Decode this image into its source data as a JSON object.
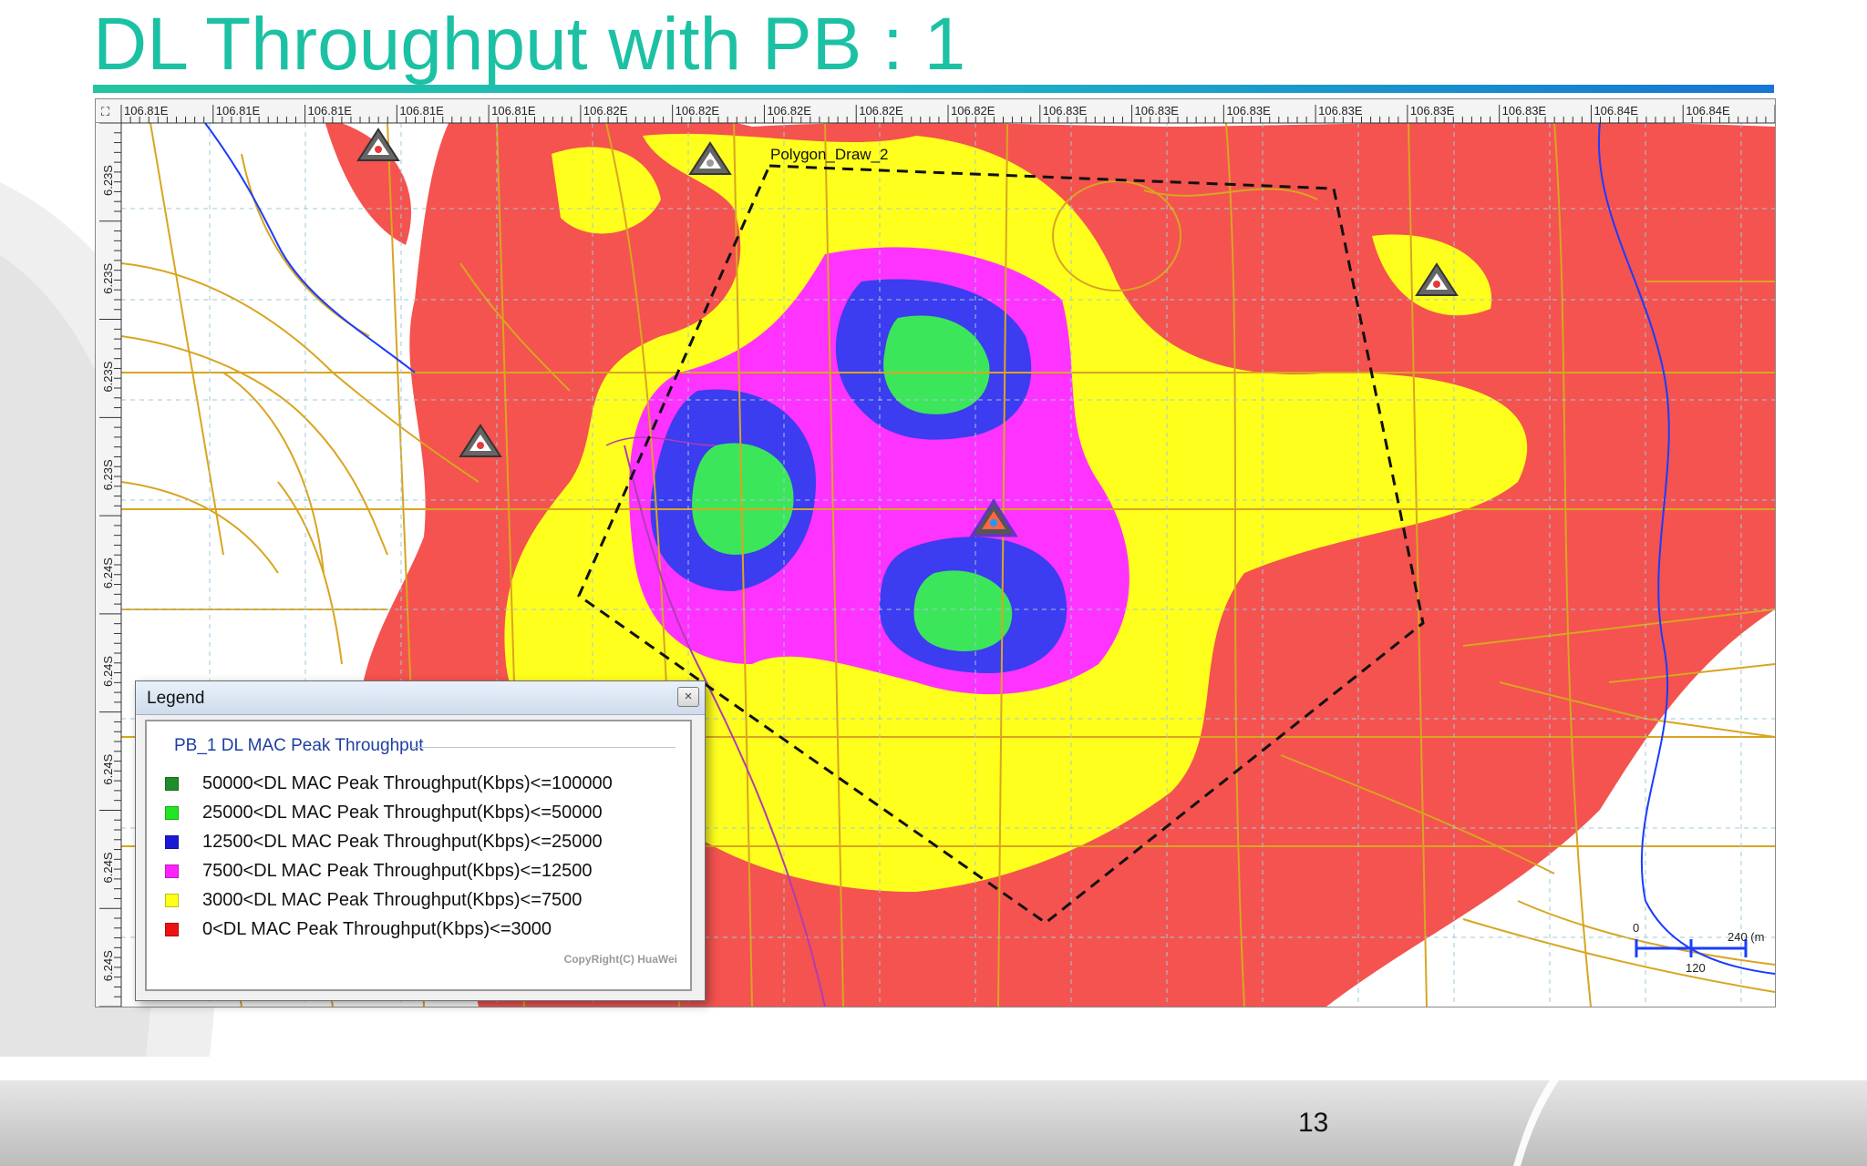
{
  "slide": {
    "title": "DL Throughput with PB : 1",
    "page_number": "13"
  },
  "map": {
    "longitude_ticks": [
      "106.81E",
      "106.81E",
      "106.81E",
      "106.81E",
      "106.81E",
      "106.82E",
      "106.82E",
      "106.82E",
      "106.82E",
      "106.82E",
      "106.83E",
      "106.83E",
      "106.83E",
      "106.83E",
      "106.83E",
      "106.83E",
      "106.84E",
      "106.84E"
    ],
    "latitude_ticks": [
      "6.23S",
      "6.23S",
      "6.23S",
      "6.23S",
      "6.24S",
      "6.24S",
      "6.24S",
      "6.24S",
      "6.24S"
    ],
    "polygon_label": "Polygon_Draw_2",
    "scale_bar": {
      "start": "0",
      "mid": "120",
      "end": "240 (m"
    },
    "colors": {
      "red": "#f4534f",
      "yellow": "#ffff1e",
      "magenta": "#ff33ff",
      "blue": "#3c3cf0",
      "green": "#3ce65a",
      "road": "#d9a520",
      "river": "#1a3cff"
    },
    "site_icons": [
      "cell-site-icon",
      "cell-site-icon",
      "cell-site-icon",
      "cell-site-icon",
      "cell-site-icon"
    ]
  },
  "legend": {
    "window_title": "Legend",
    "close_glyph": "×",
    "group_title": "PB_1 DL MAC Peak Throughput",
    "items": [
      {
        "label": "50000<DL MAC Peak Throughput(Kbps)<=100000",
        "color": "#1f8c2a"
      },
      {
        "label": "25000<DL MAC Peak Throughput(Kbps)<=50000",
        "color": "#22e622"
      },
      {
        "label": "12500<DL MAC Peak Throughput(Kbps)<=25000",
        "color": "#1a1ad6"
      },
      {
        "label": "7500<DL MAC Peak Throughput(Kbps)<=12500",
        "color": "#ff22ff"
      },
      {
        "label": "3000<DL MAC Peak Throughput(Kbps)<=7500",
        "color": "#ffff1a"
      },
      {
        "label": "0<DL MAC Peak Throughput(Kbps)<=3000",
        "color": "#ee1111"
      }
    ],
    "copyright": "CopyRight(C) HuaWei"
  }
}
